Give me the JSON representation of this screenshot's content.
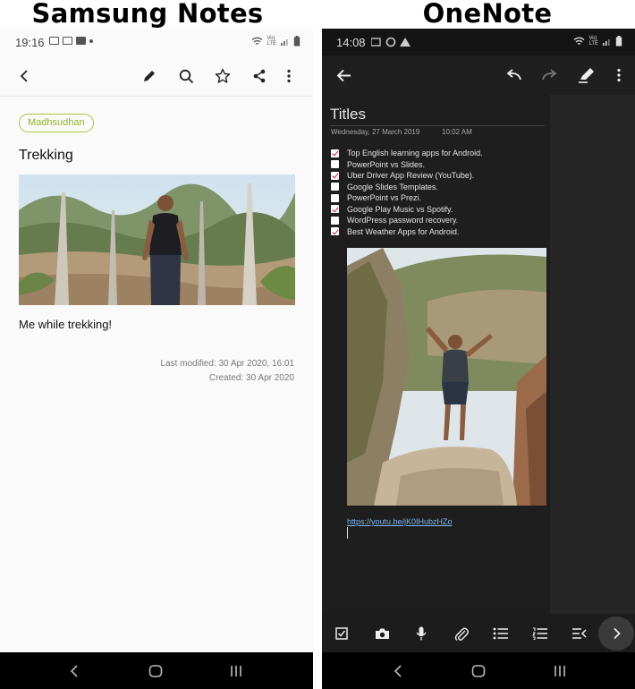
{
  "headings": {
    "left": "Samsung Notes",
    "right": "OneNote"
  },
  "samsung": {
    "status_time": "19:16",
    "status_signal_label": "Vo)\nLTE",
    "tag": "Madhsudhan",
    "note_title": "Trekking",
    "caption": "Me while trekking!",
    "last_modified": "Last modified: 30 Apr 2020, 16:01",
    "created": "Created: 30 Apr 2020",
    "accent": "#a9c83c"
  },
  "onenote": {
    "status_time": "14:08",
    "page_title": "Titles",
    "date": "Wednesday, 27 March 2019",
    "time": "10:02 AM",
    "todos": [
      {
        "text": "Top English learning apps for Android.",
        "checked": true
      },
      {
        "text": "PowerPoint vs Slides.",
        "checked": false
      },
      {
        "text": "Uber Driver App Review (YouTube).",
        "checked": true
      },
      {
        "text": "Google Slides Templates.",
        "checked": false
      },
      {
        "text": "PowerPoint vs Prezi.",
        "checked": false
      },
      {
        "text": "Google Play Music vs Spotify.",
        "checked": true
      },
      {
        "text": "WordPress password recovery.",
        "checked": false
      },
      {
        "text": "Best Weather Apps for Android.",
        "checked": true
      }
    ],
    "link": "https://youtu.be/jK0IHubzHZo",
    "check_color": "#c8183c"
  },
  "icons": {
    "samsung_toolbar": [
      "back-arrow-icon",
      "pencil-icon",
      "search-icon",
      "star-icon",
      "share-icon",
      "more-vertical-icon"
    ],
    "onenote_toolbar": [
      "back-arrow-icon",
      "undo-icon",
      "redo-icon",
      "highlighter-icon",
      "more-vertical-icon"
    ],
    "onenote_bottom": [
      "checkbox-icon",
      "camera-icon",
      "microphone-icon",
      "paperclip-icon",
      "bullet-list-icon",
      "numbered-list-icon",
      "outdent-icon",
      "chevron-right-icon"
    ],
    "nav": [
      "nav-back-icon",
      "nav-home-icon",
      "nav-recents-icon"
    ]
  }
}
